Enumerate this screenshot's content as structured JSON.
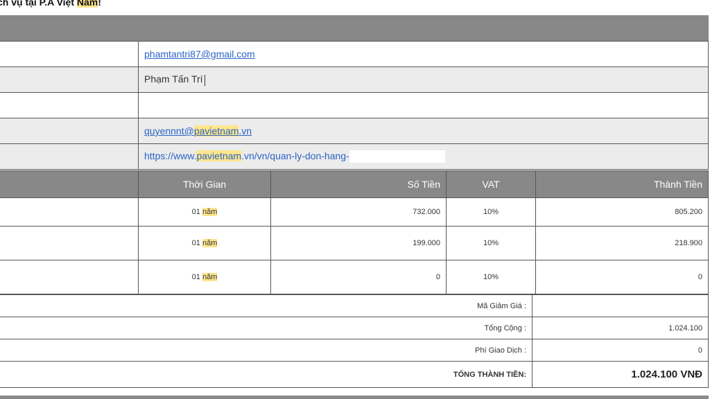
{
  "header": {
    "title_part1": "ch vụ tại P.A Việt ",
    "title_highlight": "Nam",
    "title_end": "!"
  },
  "info": {
    "rows": [
      {
        "value": "phamtantri87@gmail.com"
      },
      {
        "value": "Phạm Tấn Trí"
      },
      {
        "value": ""
      },
      {
        "value_prefix": "quyennnt@",
        "value_highlight": "pavietnam",
        "value_suffix": ".vn"
      },
      {
        "value_prefix": "https://www.",
        "value_highlight": "pavietnam",
        "value_suffix": ".vn/vn/quan-ly-don-hang-"
      }
    ]
  },
  "orders": {
    "headers": {
      "time": "Thời Gian",
      "amount": "Số Tiền",
      "vat": "VAT",
      "total": "Thành Tiền"
    },
    "rows": [
      {
        "time_num": "01",
        "time_unit": "năm",
        "amount": "732.000",
        "vat": "10%",
        "total": "805.200"
      },
      {
        "time_num": "01",
        "time_unit": "năm",
        "amount": "199.000",
        "vat": "10%",
        "total": "218.900"
      },
      {
        "time_num": "01",
        "time_unit": "năm",
        "amount": "0",
        "vat": "10%",
        "total": "0"
      }
    ]
  },
  "summary": {
    "discount_label": "Mã Giảm Giá :",
    "discount_value": "",
    "subtotal_label": "Tổng Cộng :",
    "subtotal_value": "1.024.100",
    "fee_label": "Phí Giao Dịch :",
    "fee_value": "0",
    "grand_label": "TỔNG THÀNH TIỀN:",
    "grand_value": "1.024.100 VNĐ"
  },
  "colors": {
    "header_gray": "#888888",
    "highlight": "#fde58c",
    "link": "#2a63c5"
  }
}
